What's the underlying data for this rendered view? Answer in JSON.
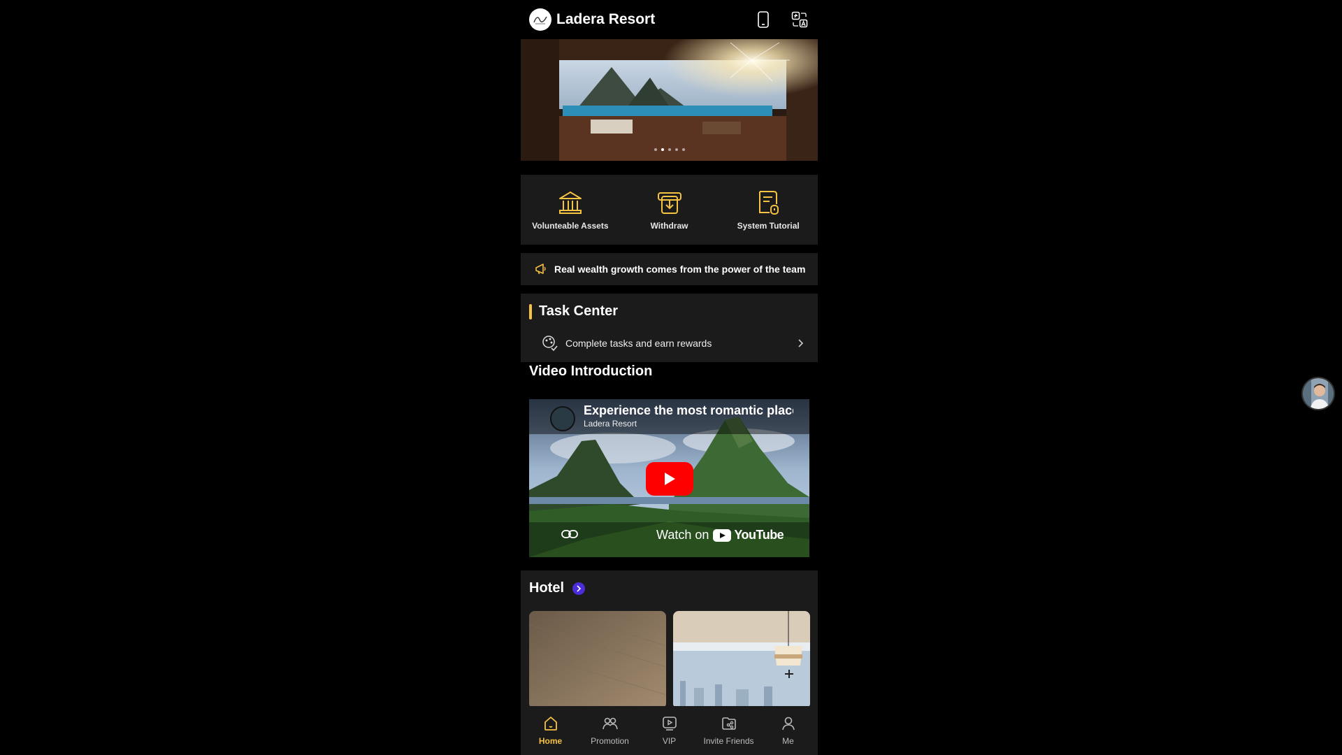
{
  "header": {
    "title": "Ladera Resort",
    "logo_icon": "ladera-logo",
    "icons": [
      "phone-icon",
      "language-icon"
    ]
  },
  "banner": {
    "slide_count": 5,
    "active_slide": 2
  },
  "quick_actions": [
    {
      "label": "Volunteable Assets",
      "icon": "bank-icon"
    },
    {
      "label": "Withdraw",
      "icon": "withdraw-icon"
    },
    {
      "label": "System Tutorial",
      "icon": "tutorial-icon"
    }
  ],
  "notice": {
    "icon": "megaphone-icon",
    "text": "Real wealth growth comes from the power of the team"
  },
  "task_center": {
    "title": "Task Center",
    "item_text": "Complete tasks and earn rewards"
  },
  "video": {
    "section_title": "Video Introduction",
    "title": "Experience the most romantic place",
    "channel": "Ladera Resort",
    "watch_label": "Watch on",
    "platform": "YouTube"
  },
  "hotel": {
    "title": "Hotel"
  },
  "bottom_nav": [
    {
      "label": "Home",
      "icon": "home-icon",
      "active": true
    },
    {
      "label": "Promotion",
      "icon": "people-icon",
      "active": false
    },
    {
      "label": "VIP",
      "icon": "video-icon",
      "active": false
    },
    {
      "label": "Invite Friends",
      "icon": "share-folder-icon",
      "active": false
    },
    {
      "label": "Me",
      "icon": "user-icon",
      "active": false
    }
  ],
  "colors": {
    "accent": "#f5c242",
    "panel": "#1b1b1b",
    "hotel_arrow": "#4d2cd9",
    "youtube_red": "#ff0000"
  }
}
